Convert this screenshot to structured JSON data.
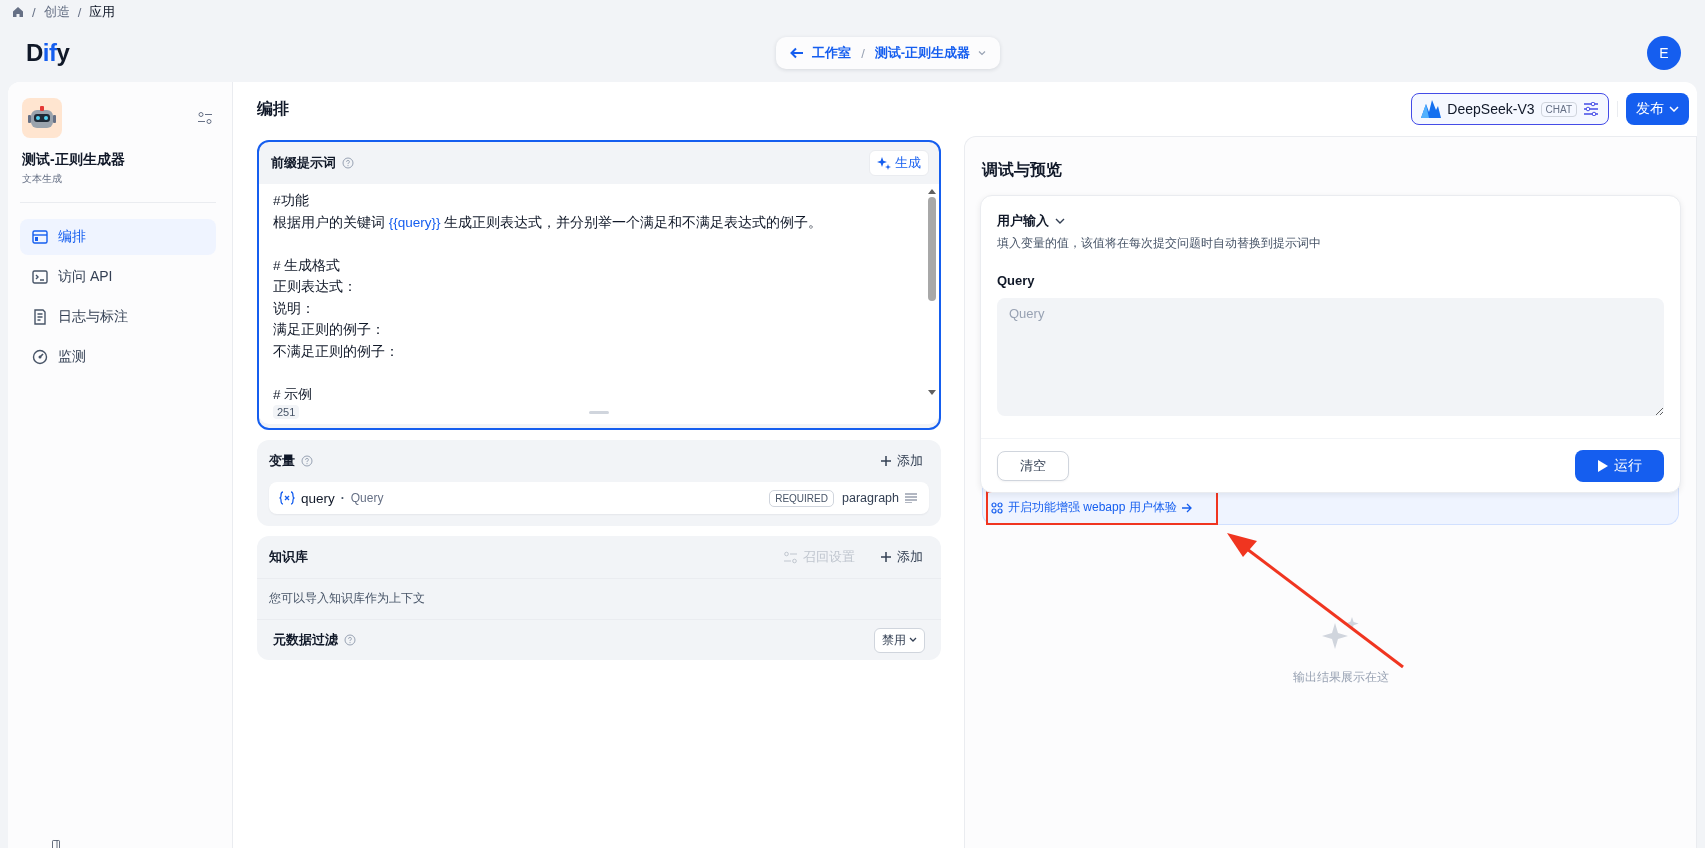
{
  "breadcrumb": [
    {
      "separator": "/",
      "label": "创造",
      "current": false
    },
    {
      "separator": "/",
      "label": "应用",
      "current": true
    }
  ],
  "logo": [
    {
      "text": "D",
      "accent": false
    },
    {
      "text": "if",
      "accent": true
    },
    {
      "text": "y",
      "accent": false
    }
  ],
  "nav_pill": {
    "back": "工作室",
    "separator": "/",
    "app": "测试-正则生成器"
  },
  "avatar": "E",
  "app": {
    "name": "测试-正则生成器",
    "type": "文本生成"
  },
  "sidebar": {
    "items": [
      {
        "label": "编排",
        "selected": true
      },
      {
        "label": "访问 API",
        "selected": false
      },
      {
        "label": "日志与标注",
        "selected": false
      },
      {
        "label": "监测",
        "selected": false
      }
    ]
  },
  "page_title": "编排",
  "model": {
    "name": "DeepSeek-V3",
    "badge": "CHAT"
  },
  "publish": "发布",
  "prompt": {
    "title": "前缀提示词",
    "generate": "生成",
    "count": "251",
    "paragraphs": [
      [
        [
          {
            "text": "#功能"
          }
        ],
        [
          {
            "text": "根据用户的关键词 "
          },
          {
            "text": "{{query}}",
            "kind": "variable"
          },
          {
            "text": " 生成正则表达式，并分别举一个满足和不满足表达式的例子。"
          }
        ]
      ],
      [
        [
          {
            "text": "# 生成格式"
          }
        ],
        [
          {
            "text": "正则表达式："
          }
        ],
        [
          {
            "text": "说明："
          }
        ],
        [
          {
            "text": "满足正则的例子："
          }
        ],
        [
          {
            "text": "不满足正则的例子："
          }
        ]
      ],
      [
        [
          {
            "text": "# 示例"
          }
        ]
      ]
    ]
  },
  "variables": {
    "title": "变量",
    "add": "添加",
    "items": [
      {
        "name": "query",
        "separator": "·",
        "label": "Query",
        "required": "REQUIRED",
        "type": "paragraph"
      }
    ]
  },
  "knowledge": {
    "title": "知识库",
    "settings": "召回设置",
    "settings_disabled": true,
    "add": "添加",
    "hint": "您可以导入知识库作为上下文",
    "metadata": {
      "title": "元数据过滤",
      "value": "禁用"
    }
  },
  "preview": {
    "title": "调试与预览",
    "inputs_title": "用户输入",
    "inputs_hint": "填入变量的值，该值将在每次提交问题时自动替换到提示词中",
    "fields": [
      {
        "label": "Query",
        "placeholder": "Query"
      }
    ],
    "clear": "清空",
    "run": "运行",
    "banner": "开启功能增强 webapp 用户体验",
    "empty": "输出结果展示在这"
  }
}
